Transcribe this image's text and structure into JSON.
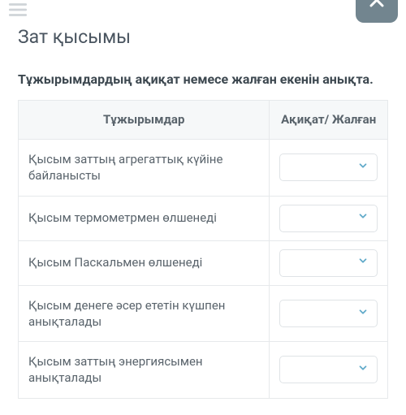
{
  "header": {
    "title": "Зат қысымы"
  },
  "instruction": "Тұжырымдардың ақиқат немесе жалған екенін анықта.",
  "table": {
    "col_statements": "Тұжырымдар",
    "col_answer": "Ақиқат/ Жалған",
    "rows": [
      {
        "text": "Қысым заттың агрегаттық күйіне байланысты"
      },
      {
        "text": "Қысым термометрмен өлшенеді"
      },
      {
        "text": "Қысым Паскальмен өлшенеді"
      },
      {
        "text": "Қысым денеге әсер ететін күшпен анықталады"
      },
      {
        "text": "Қысым заттың энергиясымен анықталады"
      }
    ]
  }
}
